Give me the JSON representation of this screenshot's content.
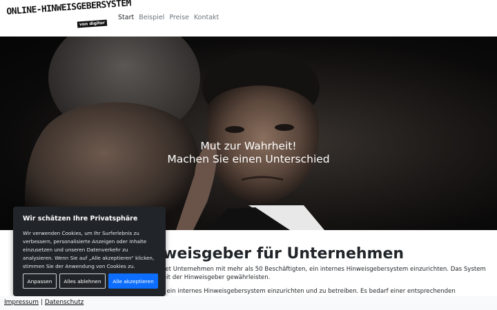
{
  "header": {
    "logo_main": "ONLINE-HINWEISGEBERSYSTEM",
    "logo_sub": "von digitor",
    "nav": [
      "Start",
      "Beispiel",
      "Preise",
      "Kontakt"
    ]
  },
  "hero": {
    "line1": "Mut zur Wahrheit!",
    "line2": "Machen Sie einen Unterschied"
  },
  "main": {
    "heading": "weisgeber für Unternehmen",
    "para1_line1": "tet Unternehmen mit mehr als 50 Beschäftigten, ein internes Hinweisgebersystem einzurichten. Das System",
    "para1_line2": "eit der Hinweisgeber gewährleisten.",
    "para2_line1": ", ein internes Hinweisgebersystem einzurichten und zu betreiben. Es bedarf einer entsprechenden"
  },
  "cookie": {
    "title": "Wir schätzen Ihre Privatsphäre",
    "text_lines": [
      "Wir verwenden Cookies, um Ihr Surferlebnis zu",
      "verbessern, personalisierte Anzeigen oder Inhalte",
      "einzusetzen und unseren Datenverkehr zu",
      "analysieren. Wenn Sie auf „Alle akzeptieren“ klicken,",
      "stimmen Sie der Anwendung von Cookies zu."
    ],
    "buttons": {
      "customize": "Anpassen",
      "reject": "Alles ablehnen",
      "accept": "Alle akzeptieren"
    },
    "accent_color": "#0d6efd",
    "background_color": "#212529"
  },
  "footer": {
    "impressum": "Impressum",
    "separator": "|",
    "datenschutz": "Datenschutz"
  }
}
